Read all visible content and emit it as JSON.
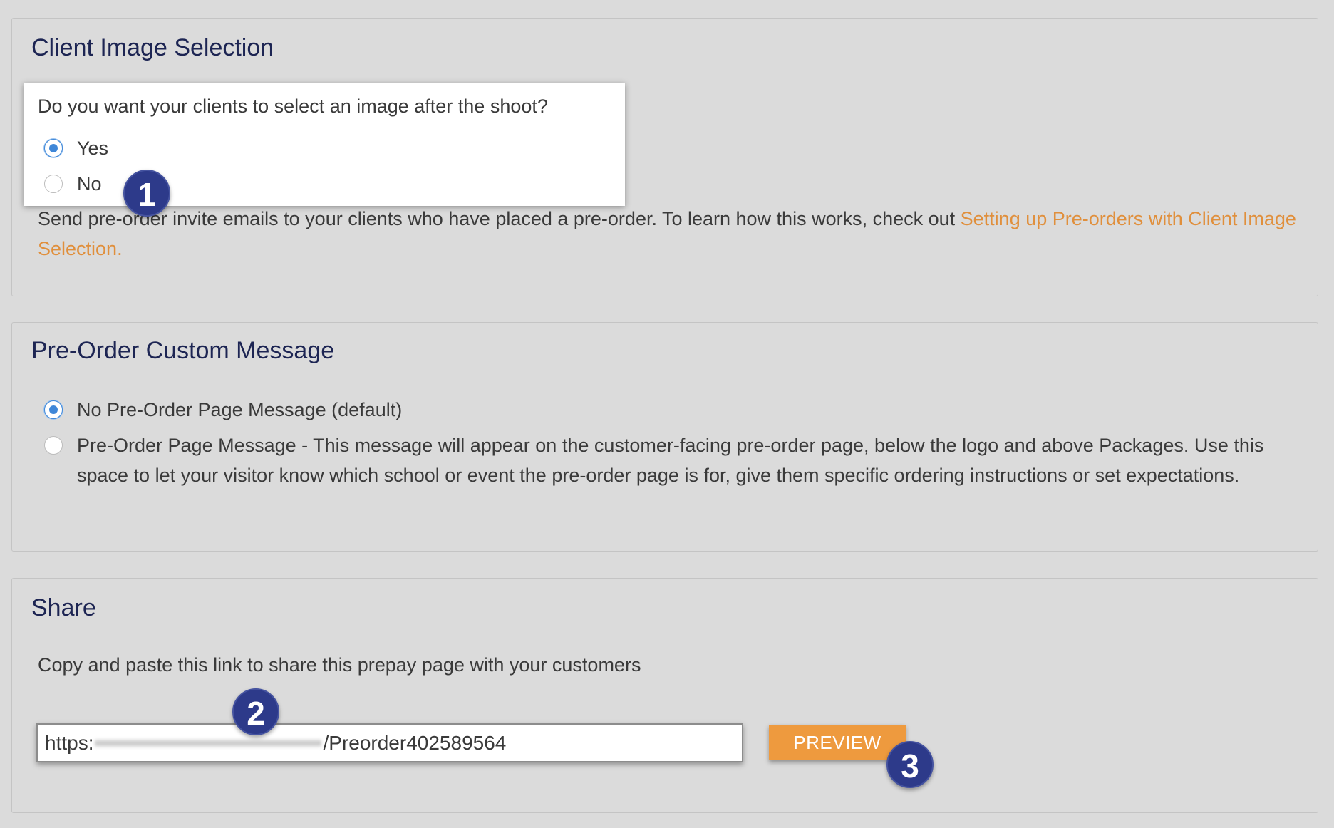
{
  "client_image_selection": {
    "title": "Client Image Selection",
    "question": "Do you want your clients to select an image after the shoot?",
    "options": [
      {
        "label": "Yes",
        "selected": true
      },
      {
        "label": "No",
        "selected": false
      }
    ],
    "description": "Send pre-order invite emails to your clients who have placed a pre-order. To learn how this works, check out ",
    "help_link": "Setting up Pre-orders with Client Image Selection."
  },
  "pre_order_custom_message": {
    "title": "Pre-Order Custom Message",
    "options": [
      {
        "label": "No Pre-Order Page Message (default)",
        "selected": true
      },
      {
        "label": "Pre-Order Page Message - This message will appear on the customer-facing pre-order page, below the logo and above Packages. Use this space to let your visitor know which school or event the pre-order page is for, give them specific ordering instructions or set expectations.",
        "selected": false
      }
    ]
  },
  "share": {
    "title": "Share",
    "instructions": "Copy and paste this link to share this prepay page with your customers",
    "url_prefix": "https:",
    "url_suffix": "/Preorder402589564",
    "preview_label": "PREVIEW"
  },
  "annotations": {
    "badge_1": "1",
    "badge_2": "2",
    "badge_3": "3"
  },
  "colors": {
    "page_background": "#dbdbdb",
    "title_color": "#1d2553",
    "link_color": "#e08f3c",
    "radio_selected": "#3f87d8",
    "preview_button": "#ee9a3e",
    "badge_background": "#2d3a8a"
  }
}
